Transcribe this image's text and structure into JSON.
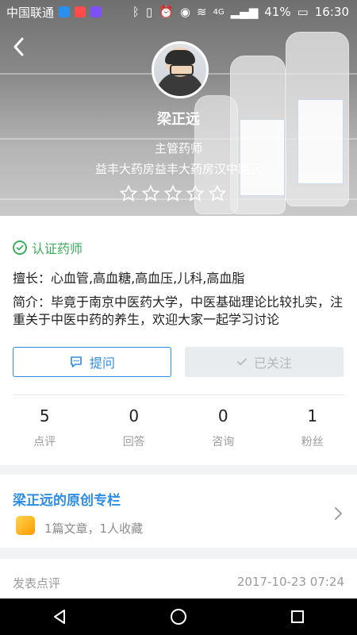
{
  "statusbar": {
    "carrier": "中国联通",
    "signal": "4G",
    "battery": "41%",
    "time": "16:30"
  },
  "profile": {
    "name": "梁正远",
    "title": "主管药师",
    "pharmacy": "益丰大药房益丰大药房汉中路店",
    "rating_stars_total": 5,
    "rating_stars_filled": 0
  },
  "verification": {
    "label": "认证药师"
  },
  "details": {
    "skills": "擅长：心血管,高血糖,高血压,儿科,高血脂",
    "intro": "简介：毕竟于南京中医药大学，中医基础理论比较扎实，注重关于中医中药的养生，欢迎大家一起学习讨论"
  },
  "actions": {
    "ask_label": "提问",
    "follow_label": "已关注"
  },
  "stats": [
    {
      "value": "5",
      "label": "点评"
    },
    {
      "value": "0",
      "label": "回答"
    },
    {
      "value": "0",
      "label": "咨询"
    },
    {
      "value": "1",
      "label": "粉丝"
    }
  ],
  "column": {
    "title": "梁正远的原创专栏",
    "meta": "1篇文章，1人收藏"
  },
  "review": {
    "label": "发表点评",
    "date": "2017-10-23 07:24"
  },
  "colors": {
    "accent": "#2d8ee8",
    "verified": "#3cae5c",
    "muted_text": "#9b9b9b"
  },
  "icons": {
    "back": "back-arrow-icon",
    "verify": "check-circle-icon",
    "ask": "chat-bubble-icon",
    "follow": "check-icon",
    "column_thumb": "column-badge-icon",
    "chevron": "chevron-right-icon"
  }
}
